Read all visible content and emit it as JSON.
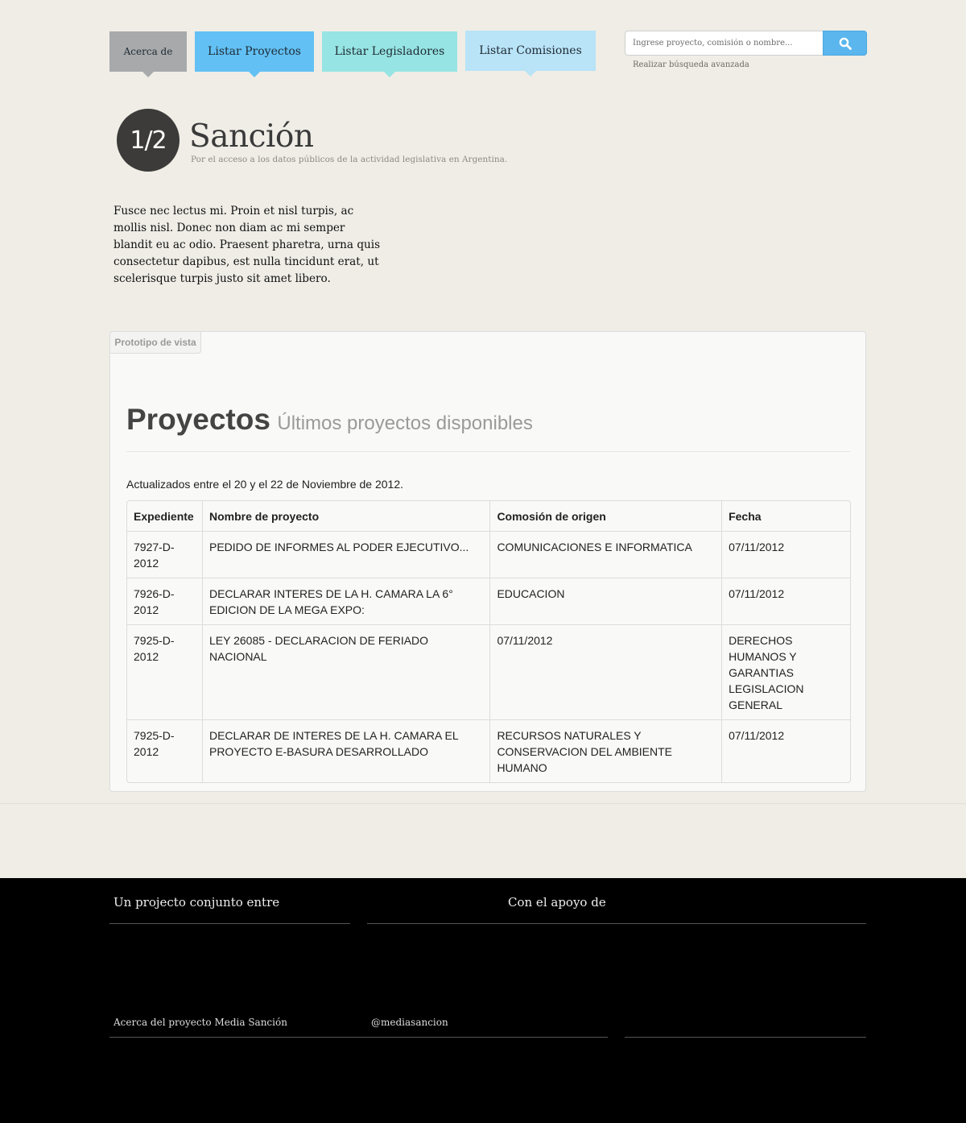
{
  "nav": {
    "tabs": [
      {
        "label": "Acerca de",
        "color": "#a7a9ab"
      },
      {
        "label": "Listar Proyectos",
        "color": "#62c0f4"
      },
      {
        "label": "Listar Legisladores",
        "color": "#96e4e3"
      },
      {
        "label": "Listar Comisiones",
        "color": "#b9e3f7"
      }
    ]
  },
  "search": {
    "placeholder": "Ingrese proyecto, comisión o nombre...",
    "button_icon": "search-icon",
    "advanced_label": "Realizar búsqueda avanzada"
  },
  "brand": {
    "logo_text": "1/2",
    "title": "Sanción",
    "tagline": "Por el acceso a los datos públicos de la actividad legislativa en Argentina."
  },
  "intro": {
    "text": "Fusce nec lectus mi. Proin et nisl turpis, ac mollis nisl. Donec non diam ac mi semper blandit eu ac odio. Praesent pharetra, urna quis consectetur dapibus, est nulla tincidunt erat, ut scelerisque turpis justo sit amet libero."
  },
  "panel": {
    "label": "Prototipo de vista",
    "heading": "Proyectos",
    "subheading": "Últimos proyectos disponibles",
    "updated_note": "Actualizados entre el 20 y el 22 de Noviembre de 2012.",
    "table": {
      "headers": [
        "Expediente",
        "Nombre de proyecto",
        "Comosión de origen",
        "Fecha"
      ],
      "rows": [
        [
          "7927-D-2012",
          "PEDIDO DE INFORMES AL PODER EJECUTIVO...",
          "COMUNICACIONES E INFORMATICA",
          "07/11/2012"
        ],
        [
          "7926-D-2012",
          "DECLARAR INTERES DE LA H. CAMARA LA 6° EDICION DE LA MEGA EXPO:",
          "EDUCACION",
          "07/11/2012"
        ],
        [
          "7925-D-2012",
          "LEY 26085 - DECLARACION DE FERIADO NACIONAL",
          "07/11/2012",
          "DERECHOS HUMANOS Y GARANTIAS LEGISLACION GENERAL"
        ],
        [
          "7925-D-2012",
          "DECLARAR DE INTERES DE LA H. CAMARA EL PROYECTO E-BASURA DESARROLLADO",
          "RECURSOS NATURALES Y CONSERVACION DEL AMBIENTE HUMANO",
          "07/11/2012"
        ]
      ]
    }
  },
  "footer": {
    "heading_left": "Un projecto conjunto entre",
    "heading_right": "Con el apoyo de",
    "link_about": "Acerca del proyecto Media Sanción",
    "link_twitter": "@mediasancion"
  },
  "colors": {
    "background": "#efede6",
    "accent_blue": "#5ab6ed",
    "footer_bg": "#000000"
  }
}
